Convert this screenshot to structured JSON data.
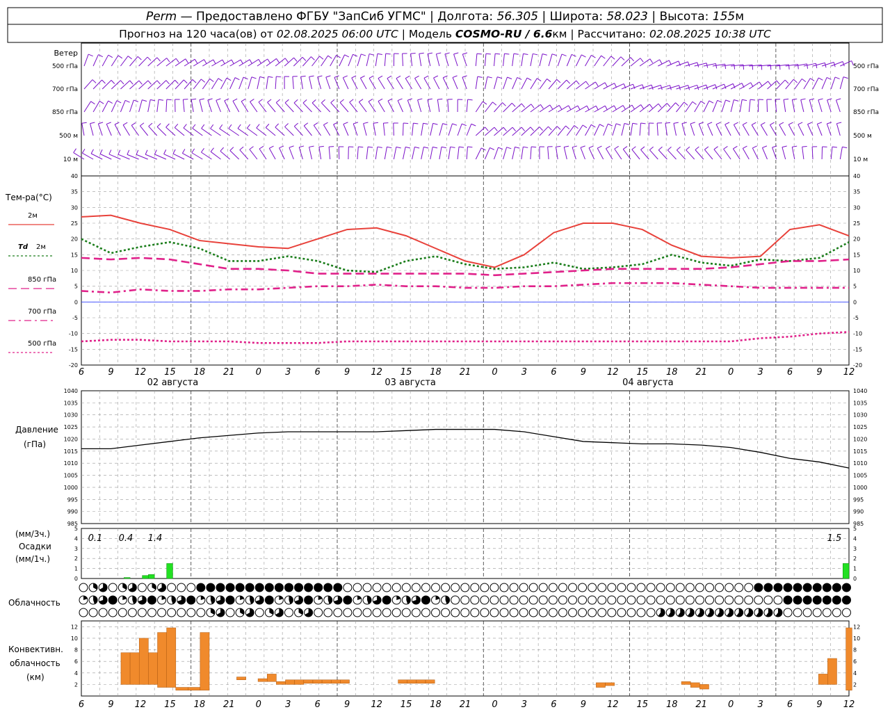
{
  "header": {
    "station": "Perm",
    "provider": " — Предоставлено ФГБУ \"ЗапСиб УГМС\" | Долгота: ",
    "lon": "56.305",
    "lat_label": " | Широта: ",
    "lat": "58.023",
    "alt_label": " | Высота: ",
    "alt": "155",
    "alt_unit": "м",
    "line2_a": "Прогноз на 120 часа(ов) от ",
    "issued": "02.08.2025 06:00 UTC",
    "line2_b": "  | Модель ",
    "model": "COSMO-RU / 6.6",
    "model_unit": "км",
    "line2_c": " | Рассчитано: ",
    "computed": "02.08.2025 10:38 UTC"
  },
  "wind": {
    "title": "Ветер",
    "levels": [
      "500 гПа",
      "700 гПа",
      "850 гПа",
      "500 м",
      "10  м"
    ],
    "color": "#7a10c8"
  },
  "temp": {
    "title": "Тем-ра(°C)",
    "legend": [
      {
        "label": "2м",
        "sub": "",
        "color": "#e8413a",
        "dash": ""
      },
      {
        "label": "Td",
        "sub": "2м",
        "color": "#1a7d1a",
        "dash": "3,3"
      },
      {
        "label": "850 гПа",
        "sub": "",
        "color": "#e0218a",
        "dash": "12,6"
      },
      {
        "label": "700 гПа",
        "sub": "",
        "color": "#e0218a",
        "dash": "10,5,3,5"
      },
      {
        "label": "500 гПа",
        "sub": "",
        "color": "#e0218a",
        "dash": "3,3"
      }
    ],
    "yticks": [
      "40",
      "35",
      "30",
      "25",
      "20",
      "15",
      "10",
      "5",
      "0",
      "-5",
      "-10",
      "-15",
      "-20"
    ]
  },
  "time_axis": {
    "labels": [
      "6",
      "9",
      "12",
      "15",
      "18",
      "21",
      "0",
      "3",
      "6",
      "9",
      "12",
      "15",
      "18",
      "21",
      "0",
      "3",
      "6",
      "9",
      "12",
      "15",
      "18",
      "21",
      "0",
      "3",
      "6",
      "9",
      "12"
    ],
    "days": [
      "02 августа",
      "03 августа",
      "04 августа"
    ]
  },
  "pressure": {
    "title": "Давление",
    "unit": "(гПа)",
    "yticks": [
      "1040",
      "1035",
      "1030",
      "1025",
      "1020",
      "1015",
      "1010",
      "1005",
      "1000",
      "995",
      "990",
      "985"
    ]
  },
  "precip": {
    "unit1": "(мм/3ч.)",
    "title": "Осадки",
    "unit2": "(мм/1ч.)",
    "yticks": [
      "5",
      "4",
      "3",
      "2",
      "1",
      "0"
    ],
    "labels": [
      "0.1",
      "0.4",
      "1.4",
      "1.5"
    ],
    "color": "#22e022"
  },
  "clouds": {
    "title": "Облачность"
  },
  "conv": {
    "title1": "Конвективн.",
    "title2": "облачность",
    "unit": "(км)",
    "yticks": [
      "12",
      "10",
      "8",
      "6",
      "4",
      "2"
    ],
    "color": "#f08a2c"
  },
  "chart_data": [
    {
      "type": "line",
      "title": "Тем-ра(°C)",
      "x": [
        "02.08 06",
        "02.08 09",
        "02.08 12",
        "02.08 15",
        "02.08 18",
        "02.08 21",
        "03.08 00",
        "03.08 03",
        "03.08 06",
        "03.08 09",
        "03.08 12",
        "03.08 15",
        "03.08 18",
        "03.08 21",
        "04.08 00",
        "04.08 03",
        "04.08 06",
        "04.08 09",
        "04.08 12",
        "04.08 15",
        "04.08 18",
        "04.08 21",
        "05.08 00",
        "05.08 03",
        "05.08 06",
        "05.08 09",
        "05.08 12"
      ],
      "ylim": [
        -20,
        40
      ],
      "series": [
        {
          "name": "2м",
          "values": [
            27,
            27.5,
            25,
            23,
            19.5,
            18.5,
            17.5,
            17,
            20,
            23,
            23.5,
            21,
            17,
            13,
            11,
            15,
            22,
            25,
            25,
            23,
            18,
            14.5,
            14,
            14.5,
            23,
            24.5,
            21
          ]
        },
        {
          "name": "Td 2м",
          "values": [
            20,
            15.5,
            17.5,
            19,
            17,
            13,
            13,
            14.5,
            13,
            10,
            9.5,
            13,
            14.5,
            12,
            10.5,
            11,
            12.5,
            10.5,
            11,
            12,
            15,
            12.5,
            11.5,
            13.5,
            13,
            14,
            19
          ]
        },
        {
          "name": "850 гПа",
          "values": [
            14,
            13.5,
            14,
            13.5,
            12,
            10.5,
            10.5,
            10,
            9,
            9,
            9,
            9,
            9,
            9,
            8.5,
            9,
            9.5,
            10,
            10.5,
            10.5,
            10.5,
            10.5,
            11,
            12,
            13,
            13,
            13.5
          ]
        },
        {
          "name": "700 гПа",
          "values": [
            3.5,
            3,
            4,
            3.5,
            3.5,
            4,
            4,
            4.5,
            5,
            5,
            5.5,
            5,
            5,
            4.5,
            4.5,
            5,
            5,
            5.5,
            6,
            6,
            6,
            5.5,
            5,
            4.5,
            4.5,
            4.5,
            4.5
          ]
        },
        {
          "name": "500 гПа",
          "values": [
            -12.5,
            -12,
            -12,
            -12.5,
            -12.5,
            -12.5,
            -13,
            -13,
            -13,
            -12.5,
            -12.5,
            -12.5,
            -12.5,
            -12.5,
            -12.5,
            -12.5,
            -12.5,
            -12.5,
            -12.5,
            -12.5,
            -12.5,
            -12.5,
            -12.5,
            -11.5,
            -11,
            -10,
            -9.5
          ]
        }
      ]
    },
    {
      "type": "line",
      "title": "Давление",
      "x": [
        "02.08 06",
        "02.08 09",
        "02.08 12",
        "02.08 15",
        "02.08 18",
        "02.08 21",
        "03.08 00",
        "03.08 03",
        "03.08 06",
        "03.08 09",
        "03.08 12",
        "03.08 15",
        "03.08 18",
        "03.08 21",
        "04.08 00",
        "04.08 03",
        "04.08 06",
        "04.08 09",
        "04.08 12",
        "04.08 15",
        "04.08 18",
        "04.08 21",
        "05.08 00",
        "05.08 03",
        "05.08 06",
        "05.08 09",
        "05.08 12"
      ],
      "ylim": [
        985,
        1040
      ],
      "series": [
        {
          "name": "",
          "values": [
            1016,
            1016,
            1017.5,
            1019,
            1020.5,
            1021.5,
            1022.5,
            1023,
            1023,
            1023,
            1023,
            1023.5,
            1024,
            1024,
            1024,
            1023,
            1021,
            1019,
            1018.5,
            1018,
            1018,
            1017.5,
            1016.5,
            1014.5,
            1012,
            1010.5,
            1008
          ]
        }
      ]
    },
    {
      "type": "bar",
      "title": "Осадки",
      "ylim": [
        0,
        5
      ],
      "bars": [
        {
          "t": 7.0,
          "w": 1.0,
          "v": 0.1
        },
        {
          "t": 10.0,
          "w": 1.0,
          "v": 0.3
        },
        {
          "t": 11.0,
          "w": 1.0,
          "v": 0.4
        },
        {
          "t": 14.0,
          "w": 1.0,
          "v": 1.5
        },
        {
          "t": 125.0,
          "w": 1.0,
          "v": 1.5
        }
      ]
    },
    {
      "type": "bar",
      "title": "Конвективн. облачность (км)",
      "ylim": [
        0,
        13
      ],
      "bars": [
        {
          "t": 6.5,
          "w": 1.5,
          "lo": 2.0,
          "hi": 7.5
        },
        {
          "t": 8.0,
          "w": 1.5,
          "lo": 2.0,
          "hi": 7.5
        },
        {
          "t": 9.5,
          "w": 1.5,
          "lo": 2.0,
          "hi": 10.0
        },
        {
          "t": 11.0,
          "w": 1.5,
          "lo": 2.0,
          "hi": 7.5
        },
        {
          "t": 12.5,
          "w": 1.5,
          "lo": 1.5,
          "hi": 11.0
        },
        {
          "t": 14.0,
          "w": 1.5,
          "lo": 1.5,
          "hi": 11.8
        },
        {
          "t": 15.5,
          "w": 2.0,
          "lo": 1.0,
          "hi": 1.5
        },
        {
          "t": 17.5,
          "w": 2.0,
          "lo": 1.0,
          "hi": 1.5
        },
        {
          "t": 19.5,
          "w": 1.5,
          "lo": 1.0,
          "hi": 11.0
        },
        {
          "t": 25.5,
          "w": 1.5,
          "lo": 2.8,
          "hi": 3.3
        },
        {
          "t": 29.0,
          "w": 1.5,
          "lo": 2.5,
          "hi": 3.0
        },
        {
          "t": 30.5,
          "w": 1.5,
          "lo": 2.5,
          "hi": 3.8
        },
        {
          "t": 32.0,
          "w": 1.5,
          "lo": 2.0,
          "hi": 2.5
        },
        {
          "t": 33.5,
          "w": 1.5,
          "lo": 2.0,
          "hi": 2.8
        },
        {
          "t": 35.0,
          "w": 1.5,
          "lo": 2.0,
          "hi": 2.8
        },
        {
          "t": 36.5,
          "w": 1.5,
          "lo": 2.2,
          "hi": 2.8
        },
        {
          "t": 38.0,
          "w": 1.5,
          "lo": 2.2,
          "hi": 2.8
        },
        {
          "t": 39.5,
          "w": 1.5,
          "lo": 2.2,
          "hi": 2.8
        },
        {
          "t": 41.0,
          "w": 1.5,
          "lo": 2.2,
          "hi": 2.8
        },
        {
          "t": 42.5,
          "w": 1.5,
          "lo": 2.2,
          "hi": 2.8
        },
        {
          "t": 52.0,
          "w": 1.5,
          "lo": 2.2,
          "hi": 2.8
        },
        {
          "t": 53.5,
          "w": 1.5,
          "lo": 2.2,
          "hi": 2.8
        },
        {
          "t": 55.0,
          "w": 1.5,
          "lo": 2.2,
          "hi": 2.8
        },
        {
          "t": 56.5,
          "w": 1.5,
          "lo": 2.2,
          "hi": 2.8
        },
        {
          "t": 84.5,
          "w": 1.5,
          "lo": 1.5,
          "hi": 2.3
        },
        {
          "t": 86.0,
          "w": 1.5,
          "lo": 1.8,
          "hi": 2.3
        },
        {
          "t": 98.5,
          "w": 1.5,
          "lo": 2.0,
          "hi": 2.5
        },
        {
          "t": 100.0,
          "w": 1.5,
          "lo": 1.5,
          "hi": 2.3
        },
        {
          "t": 101.5,
          "w": 1.5,
          "lo": 1.2,
          "hi": 2.0
        },
        {
          "t": 121.0,
          "w": 1.5,
          "lo": 2.0,
          "hi": 3.8
        },
        {
          "t": 122.5,
          "w": 1.5,
          "lo": 2.0,
          "hi": 6.5
        },
        {
          "t": 125.5,
          "w": 1.0,
          "lo": 1.0,
          "hi": 11.8
        }
      ]
    }
  ]
}
